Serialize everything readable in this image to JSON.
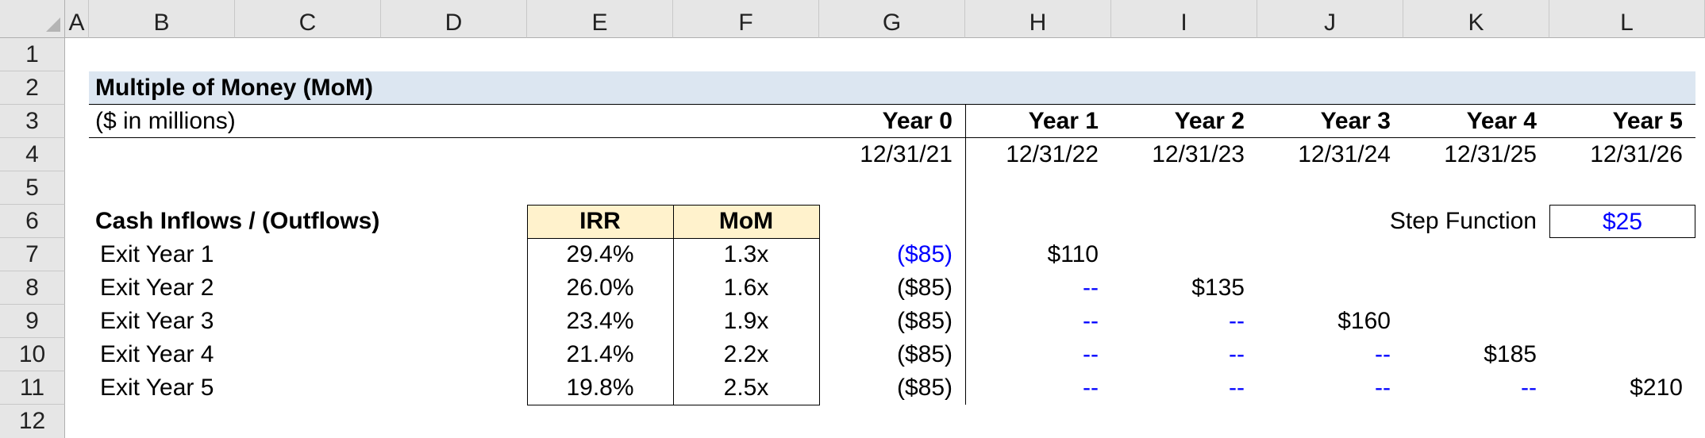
{
  "columns": [
    "A",
    "B",
    "C",
    "D",
    "E",
    "F",
    "G",
    "H",
    "I",
    "J",
    "K",
    "L"
  ],
  "rows": [
    "1",
    "2",
    "3",
    "4",
    "5",
    "6",
    "7",
    "8",
    "9",
    "10",
    "11"
  ],
  "partial_row": "12",
  "title": "Multiple of Money (MoM)",
  "units_label": "($ in millions)",
  "years": [
    "Year 0",
    "Year 1",
    "Year 2",
    "Year 3",
    "Year 4",
    "Year 5"
  ],
  "dates": [
    "12/31/21",
    "12/31/22",
    "12/31/23",
    "12/31/24",
    "12/31/25",
    "12/31/26"
  ],
  "cash_flows_label": "Cash Inflows / (Outflows)",
  "irr_header": "IRR",
  "mom_header": "MoM",
  "step_function_label": "Step Function",
  "step_function_value": "$25",
  "exits": [
    {
      "label": "Exit Year 1",
      "irr": "29.4%",
      "mom": "1.3x",
      "y0": "($85)",
      "y1": "$110",
      "y2": "",
      "y3": "",
      "y4": "",
      "y5": ""
    },
    {
      "label": "Exit Year 2",
      "irr": "26.0%",
      "mom": "1.6x",
      "y0": "($85)",
      "y1": "--",
      "y2": "$135",
      "y3": "",
      "y4": "",
      "y5": ""
    },
    {
      "label": "Exit Year 3",
      "irr": "23.4%",
      "mom": "1.9x",
      "y0": "($85)",
      "y1": "--",
      "y2": "--",
      "y3": "$160",
      "y4": "",
      "y5": ""
    },
    {
      "label": "Exit Year 4",
      "irr": "21.4%",
      "mom": "2.2x",
      "y0": "($85)",
      "y1": "--",
      "y2": "--",
      "y3": "--",
      "y4": "$185",
      "y5": ""
    },
    {
      "label": "Exit Year 5",
      "irr": "19.8%",
      "mom": "2.5x",
      "y0": "($85)",
      "y1": "--",
      "y2": "--",
      "y3": "--",
      "y4": "--",
      "y5": "$210"
    }
  ],
  "colors": {
    "title_band": "#dce6f1",
    "irr_mom_header_fill": "#fff2cc",
    "input_blue": "#0000ff",
    "header_gray": "#e6e6e6"
  }
}
